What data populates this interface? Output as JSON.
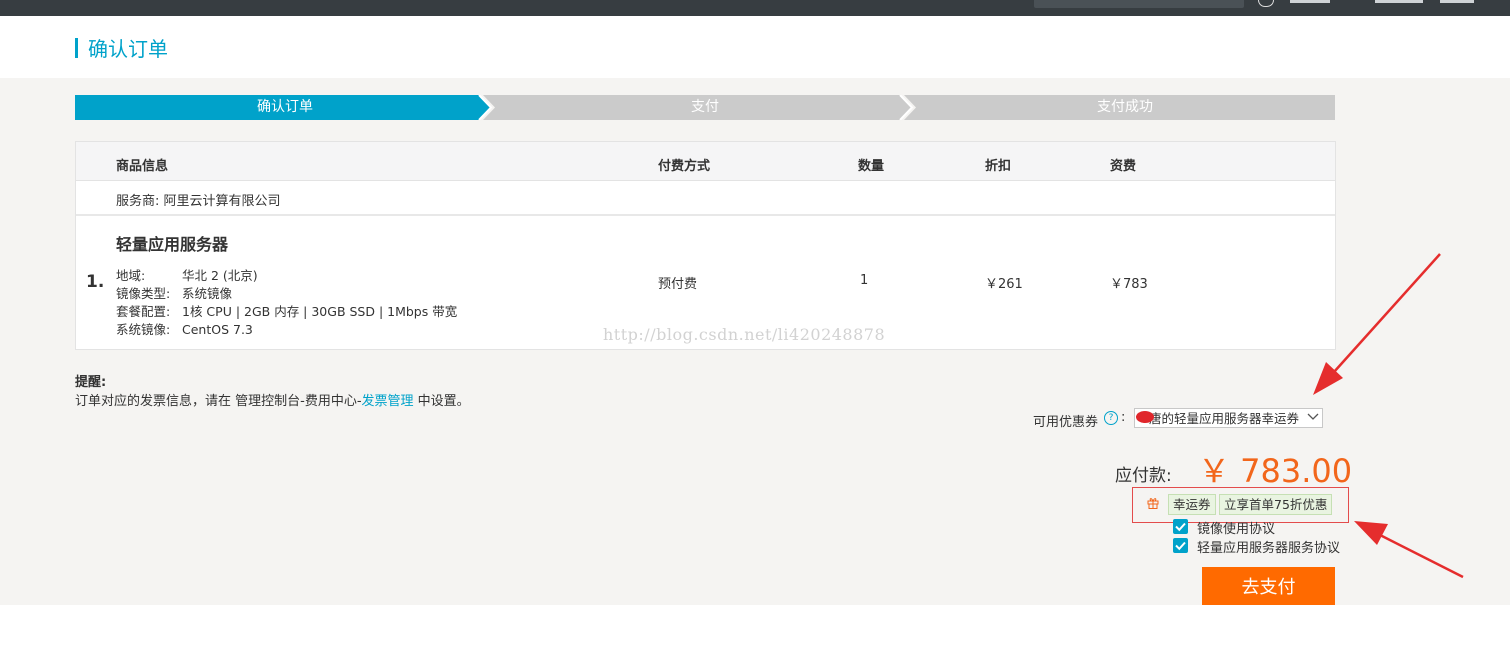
{
  "page": {
    "title": "确认订单"
  },
  "steps": [
    {
      "label": "确认订单",
      "active": true
    },
    {
      "label": "支付",
      "active": false
    },
    {
      "label": "支付成功",
      "active": false
    }
  ],
  "table": {
    "headers": {
      "product": "商品信息",
      "billing": "付费方式",
      "quantity": "数量",
      "discount": "折扣",
      "fee": "资费"
    },
    "vendor": "服务商: 阿里云计算有限公司",
    "rows": [
      {
        "index": "1.",
        "name": "轻量应用服务器",
        "specs": [
          {
            "key": "地域:",
            "value": "华北 2 (北京)"
          },
          {
            "key": "镜像类型:",
            "value": "系统镜像"
          },
          {
            "key": "套餐配置:",
            "value": "1核 CPU | 2GB 内存 | 30GB SSD | 1Mbps 带宽"
          },
          {
            "key": "系统镜像:",
            "value": "CentOS 7.3"
          }
        ],
        "billing": "预付费",
        "quantity": "1",
        "discount": "￥261",
        "fee": "￥783"
      }
    ]
  },
  "watermark": "http://blog.csdn.net/li420248878",
  "notice": {
    "title": "提醒:",
    "text_before": "订单对应的发票信息，请在 管理控制台-费用中心-",
    "link": "发票管理",
    "text_after": " 中设置。"
  },
  "coupon": {
    "label": "可用优惠券",
    "help": "?",
    "colon": ":",
    "selected": "唐的轻量应用服务器幸运券"
  },
  "total": {
    "label": "应付款:",
    "value": "￥ 783.00"
  },
  "promo": {
    "tags": [
      "幸运券",
      "立享首单75折优惠"
    ]
  },
  "agreements": [
    {
      "label": "镜像使用协议",
      "checked": true
    },
    {
      "label": "轻量应用服务器服务协议",
      "checked": true
    }
  ],
  "pay_button": "去支付",
  "colors": {
    "accent": "#00a2ca",
    "orange": "#ff6a00",
    "price": "#f2661b",
    "annotation": "#e52d2d"
  }
}
